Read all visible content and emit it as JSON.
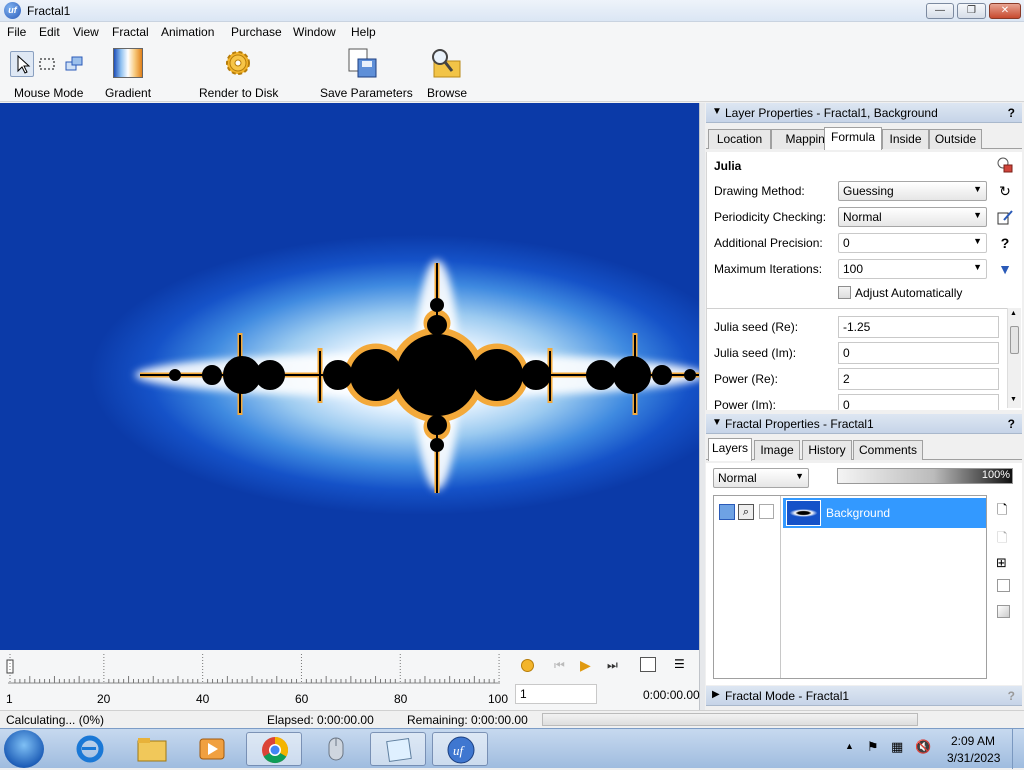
{
  "window": {
    "title": "Fractal1",
    "minimize": "—",
    "restore": "❐",
    "close": "✕",
    "app_icon_text": "uf"
  },
  "menu": [
    "File",
    "Edit",
    "View",
    "Fractal",
    "Animation",
    "Purchase",
    "Window",
    "Help"
  ],
  "toolbar": {
    "mouse_mode": "Mouse Mode",
    "gradient": "Gradient",
    "render_to_disk": "Render to Disk",
    "save_parameters": "Save Parameters",
    "browse": "Browse"
  },
  "layer_properties": {
    "header": "Layer Properties - Fractal1, Background",
    "help": "?",
    "tabs": [
      "Location",
      "Mapping",
      "Formula",
      "Inside",
      "Outside"
    ],
    "active_tab": "Formula",
    "formula_name": "Julia",
    "drawing_method_label": "Drawing Method:",
    "drawing_method_value": "Guessing",
    "periodicity_label": "Periodicity Checking:",
    "periodicity_value": "Normal",
    "precision_label": "Additional Precision:",
    "precision_value": "0",
    "max_iter_label": "Maximum Iterations:",
    "max_iter_value": "100",
    "adjust_auto_label": "Adjust Automatically",
    "adjust_auto_checked": false,
    "seed_re_label": "Julia seed (Re):",
    "seed_re_value": "-1.25",
    "seed_im_label": "Julia seed (Im):",
    "seed_im_value": "0",
    "power_re_label": "Power (Re):",
    "power_re_value": "2",
    "power_im_label": "Power (Im):",
    "power_im_value": "0"
  },
  "fractal_properties": {
    "header": "Fractal Properties - Fractal1",
    "help": "?",
    "tabs": [
      "Layers",
      "Image",
      "History",
      "Comments"
    ],
    "active_tab": "Layers",
    "blend_mode": "Normal",
    "opacity": "100%",
    "layers": [
      {
        "name": "Background",
        "selected": true
      }
    ]
  },
  "fractal_mode": {
    "header": "Fractal Mode - Fractal1",
    "help": "?"
  },
  "timeline": {
    "tick_labels": [
      "1",
      "20",
      "40",
      "60",
      "80",
      "100"
    ],
    "frame_value": "1",
    "time": "0:00:00.00"
  },
  "status": {
    "calculating": "Calculating... (0%)",
    "elapsed": "Elapsed: 0:00:00.00",
    "remaining": "Remaining: 0:00:00.00"
  },
  "taskbar": {
    "time": "2:09 AM",
    "date": "3/31/2023"
  },
  "colors": {
    "accent_selection": "#3399ff",
    "fractal_blue": "#1552c8",
    "fractal_glow": "#ffffff"
  }
}
